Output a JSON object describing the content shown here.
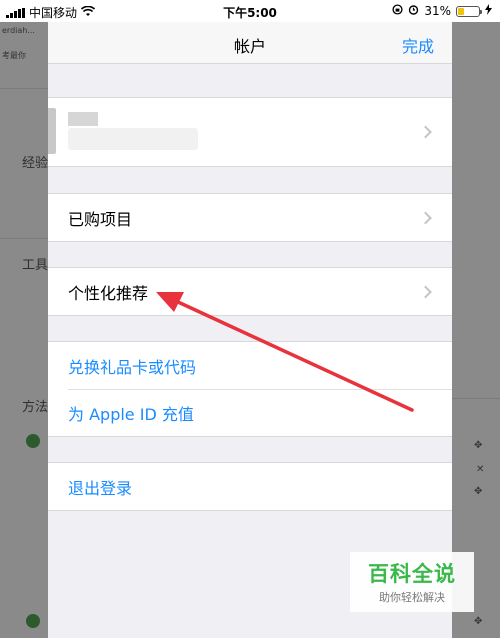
{
  "status_bar": {
    "carrier": "中国移动",
    "time": "下午5:00",
    "battery_percent": "31%",
    "battery_level": 0.31,
    "battery_color": "#f4c20d"
  },
  "background_page": {
    "frag_1": "经验",
    "frag_2": "工具",
    "frag_3": "方法"
  },
  "navbar": {
    "title": "帐户",
    "done": "完成"
  },
  "menu": {
    "purchased": "已购项目",
    "personalized": "个性化推荐",
    "redeem": "兑换礼品卡或代码",
    "add_funds": "为 Apple ID 充值",
    "sign_out": "退出登录"
  },
  "colors": {
    "accent": "#1a8cff",
    "arrow": "#e8323c"
  },
  "watermark": {
    "title": "百科全说",
    "subtitle": "助你轻松解决"
  }
}
